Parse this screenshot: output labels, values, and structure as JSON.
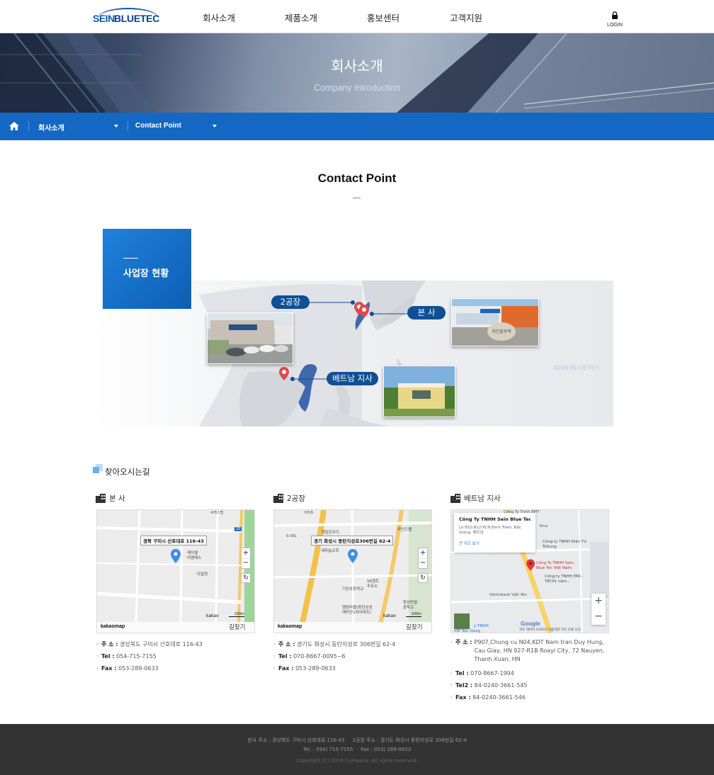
{
  "header": {
    "logo_left": "SEIN",
    "logo_right": "BLUETEC",
    "nav": [
      "회사소개",
      "제품소개",
      "홍보센터",
      "고객지원"
    ],
    "login_label": "LOGIN",
    "login_icon": "lock-icon"
  },
  "hero": {
    "title": "회사소개",
    "subtitle": "Company introduction"
  },
  "breadcrumb": {
    "home_icon": "home-icon",
    "level1": "회사소개",
    "level2": "Contact Point"
  },
  "section": {
    "title": "Contact Point"
  },
  "sites": {
    "box_title": "사업장 현황",
    "labels": {
      "factory2": "2공장",
      "hq": "본 사",
      "vietnam": "베트남 지사"
    },
    "watermark": "SEIN BLUETEC",
    "sign_text": "세인블루텍"
  },
  "directions": {
    "title": "찾아오시는길",
    "offices": [
      {
        "name": "본 사",
        "map": {
          "provider": "kakaomap",
          "route_label": "길찾기",
          "address_label": "경북 구미시 산호대로 116-43",
          "scale": "100m",
          "brand": "kakao",
          "places": [
            "케이엘\n이엠에스",
            "다일정",
            "씨케스텝"
          ],
          "road_number": "33"
        },
        "rows": [
          {
            "k": "주 소 :",
            "v": "경상북도 구미시 산호대로 116-43"
          },
          {
            "k": "Tel :",
            "v": "054-715-7155"
          },
          {
            "k": "Fax :",
            "v": "053-289-0633"
          }
        ]
      },
      {
        "name": "2공장",
        "map": {
          "provider": "kakaomap",
          "route_label": "길찾기",
          "address_label": "경기 화성시 동탄지성로306번길 62-4",
          "scale": "100m",
          "brand": "kakao",
          "places": [
            "S-OIL",
            "청담은무드",
            "새하늘교회",
            "SK엠트\n주유소",
            "기산초등학교",
            "화성반월\n중학교",
            "행림마을(동탄삼성\n래미안1차아파트)",
            "마인드팰",
            "아파트"
          ]
        },
        "rows": [
          {
            "k": "주 소 :",
            "v": "경기도 화성시 동탄지성로 306번길 62-4"
          },
          {
            "k": "Tel :",
            "v": "070-8667-0095~6"
          },
          {
            "k": "Fax :",
            "v": "053-289-0633"
          }
        ]
      },
      {
        "name": "베트남 지사",
        "map": {
          "provider": "google",
          "card_title": "Công Ty TNHH Sein Blue Tec ...",
          "card_addr": "Lô B10,B12 KCN Đình Trám, Bắc Giang, 베트남",
          "card_link": "큰 지도 보기",
          "places": [
            "Công Ty Tnhh BMT",
            "Vina",
            "Công ty TNHH Điện Tử TeSung",
            "Công Ty TNHH Sein Blue Tec Việt Nam",
            "Công ty TNHH FAS -TECH( nâm...",
            "Vietinbank Việt Yên",
            "y TNHH",
            "VBF Bắc Giang"
          ],
          "brand": "Google",
          "footer_text": "지도 데이터 ©2021 이용약관 지도 오류 신고"
        },
        "rows": [
          {
            "k": "주 소 :",
            "v": "P907,Chung cu N04,KDT Nam tran Duy Hung, Cau Giay, HN 927-R1B Roayl City, 72 Nauyen, Thanh Xuan, HN"
          },
          {
            "k": "Tel :",
            "v": "070-8667-1994"
          },
          {
            "k": "Tel2 :",
            "v": "84-0240-3661-545"
          },
          {
            "k": "Fax :",
            "v": "84-0240-3661-546"
          }
        ]
      }
    ]
  },
  "footer": {
    "line1": "본사 주소 : 경상북도 구미시 산호대로 116-43     2공장 주소 : 경기도 화성시 동탄지성로 306번길 62-4",
    "line2": "Tel. : 054) 715-7155     Fax : 053) 289-0633",
    "line3": "Copyright (C) 2019 Company. All rights reserved."
  },
  "colors": {
    "brand_blue": "#1468c4",
    "navy_pill": "#0f4f95",
    "pin_red": "#e53935",
    "footer_bg": "#333333"
  }
}
